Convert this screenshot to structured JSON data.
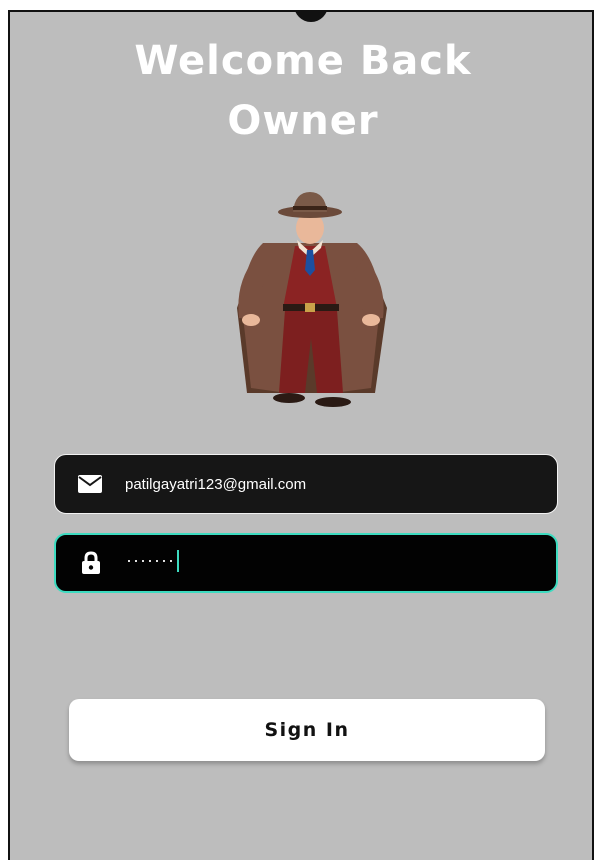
{
  "header": {
    "title_line1": "Welcome Back",
    "title_line2": "Owner"
  },
  "hero": {
    "illustration": "detective-owner-illustration"
  },
  "form": {
    "email": {
      "icon": "mail-icon",
      "value": "patilgayatri123@gmail.com"
    },
    "password": {
      "icon": "lock-icon",
      "masked_value": "·······",
      "focused": true
    }
  },
  "actions": {
    "sign_in_label": "Sign In"
  },
  "colors": {
    "background": "#bdbdbd",
    "field_dark": "#161616",
    "focus_accent": "#3ddbc0",
    "button_bg": "#ffffff"
  }
}
